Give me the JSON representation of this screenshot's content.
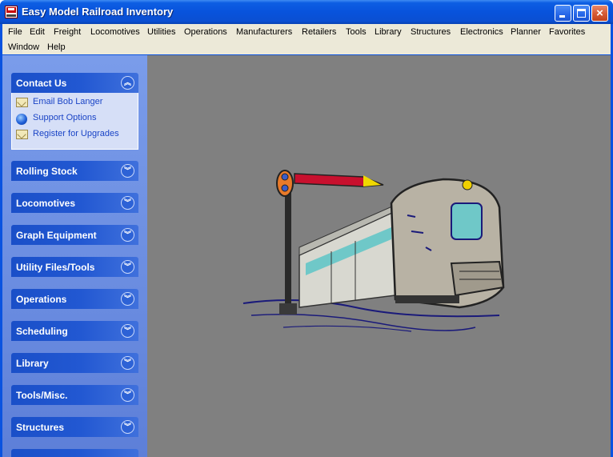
{
  "window": {
    "title": "Easy Model Railroad Inventory",
    "buttons": {
      "minimize": "minimize-icon",
      "maximize": "maximize-icon",
      "close": "×"
    }
  },
  "menu": {
    "items": [
      "File",
      "Edit",
      "Freight",
      "Locomotives",
      "Utilities",
      "Operations",
      "Manufacturers",
      "Retailers",
      "Tools",
      "Library",
      "Structures",
      "Electronics",
      "Planner",
      "Favorites",
      "Window",
      "Help"
    ]
  },
  "sidebar": {
    "contact": {
      "title": "Contact Us",
      "expanded": true,
      "tasks": [
        {
          "label": "Email Bob Langer",
          "icon": "envelope-icon"
        },
        {
          "label": "Support Options",
          "icon": "globe-icon"
        },
        {
          "label": "Register for Upgrades",
          "icon": "envelope-icon"
        }
      ]
    },
    "groups": [
      "Rolling Stock",
      "Locomotives",
      "Graph Equipment",
      "Utility Files/Tools",
      "Operations",
      "Scheduling",
      "Library",
      "Tools/Misc.",
      "Structures"
    ],
    "chevron_up": "︽",
    "chevron_down": "︾"
  },
  "main": {
    "background_color": "#808080",
    "illustration": "train-with-semaphore-signal"
  },
  "colors": {
    "titlebar": "#0853dc",
    "sidebar": "#6a8ce0",
    "group_header": "#2258d2",
    "link": "#1a44c6"
  }
}
